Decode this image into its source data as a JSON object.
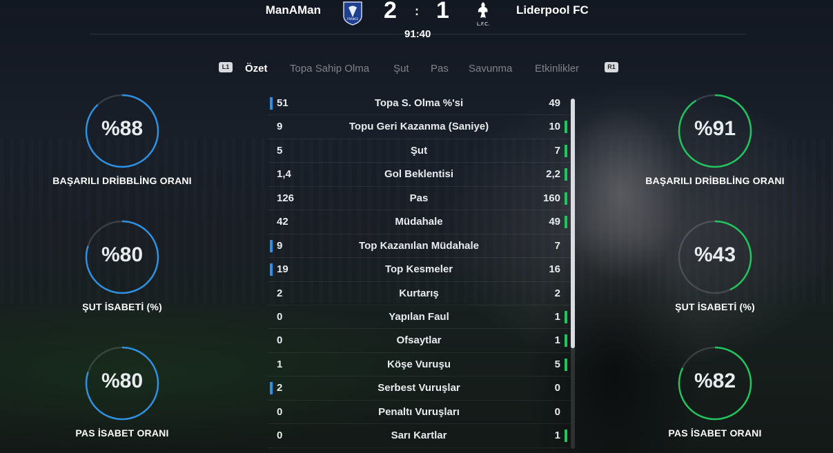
{
  "match": {
    "home_team": "ManAMan",
    "away_team": "Liderpool FC",
    "home_score": "2",
    "separator": ":",
    "away_score": "1",
    "clock": "91:40",
    "home_crest_text": "FRANCE",
    "away_crest_text": "L.F.C."
  },
  "tabs": {
    "left_hint": "L1",
    "right_hint": "R1",
    "items": [
      {
        "label": "Özet",
        "active": true
      },
      {
        "label": "Topa Sahip Olma",
        "active": false
      },
      {
        "label": "Şut",
        "active": false
      },
      {
        "label": "Pas",
        "active": false
      },
      {
        "label": "Savunma",
        "active": false
      },
      {
        "label": "Etkinlikler",
        "active": false
      }
    ]
  },
  "colors": {
    "home_accent": "#2f8fe0",
    "away_accent": "#21c55d"
  },
  "left_stats": [
    {
      "value": "%88",
      "percent": 88,
      "label": "BAŞARILI DRİBBLİNG ORANI"
    },
    {
      "value": "%80",
      "percent": 80,
      "label": "ŞUT İSABETİ (%)"
    },
    {
      "value": "%80",
      "percent": 80,
      "label": "PAS İSABET ORANI"
    }
  ],
  "right_stats": [
    {
      "value": "%91",
      "percent": 91,
      "label": "BAŞARILI DRİBBLİNG ORANI"
    },
    {
      "value": "%43",
      "percent": 43,
      "label": "ŞUT İSABETİ (%)"
    },
    {
      "value": "%82",
      "percent": 82,
      "label": "PAS İSABET ORANI"
    }
  ],
  "stats_table": [
    {
      "home": "51",
      "name": "Topa S. Olma %'si",
      "away": "49",
      "leader": "home"
    },
    {
      "home": "9",
      "name": "Topu Geri Kazanma (Saniye)",
      "away": "10",
      "leader": "away"
    },
    {
      "home": "5",
      "name": "Şut",
      "away": "7",
      "leader": "away"
    },
    {
      "home": "1,4",
      "name": "Gol Beklentisi",
      "away": "2,2",
      "leader": "away"
    },
    {
      "home": "126",
      "name": "Pas",
      "away": "160",
      "leader": "away"
    },
    {
      "home": "42",
      "name": "Müdahale",
      "away": "49",
      "leader": "away"
    },
    {
      "home": "9",
      "name": "Top Kazanılan Müdahale",
      "away": "7",
      "leader": "home"
    },
    {
      "home": "19",
      "name": "Top Kesmeler",
      "away": "16",
      "leader": "home"
    },
    {
      "home": "2",
      "name": "Kurtarış",
      "away": "2",
      "leader": "none"
    },
    {
      "home": "0",
      "name": "Yapılan Faul",
      "away": "1",
      "leader": "away"
    },
    {
      "home": "0",
      "name": "Ofsaytlar",
      "away": "1",
      "leader": "away"
    },
    {
      "home": "1",
      "name": "Köşe Vuruşu",
      "away": "5",
      "leader": "away"
    },
    {
      "home": "2",
      "name": "Serbest Vuruşlar",
      "away": "0",
      "leader": "home"
    },
    {
      "home": "0",
      "name": "Penaltı Vuruşları",
      "away": "0",
      "leader": "none"
    },
    {
      "home": "0",
      "name": "Sarı Kartlar",
      "away": "1",
      "leader": "away"
    }
  ]
}
